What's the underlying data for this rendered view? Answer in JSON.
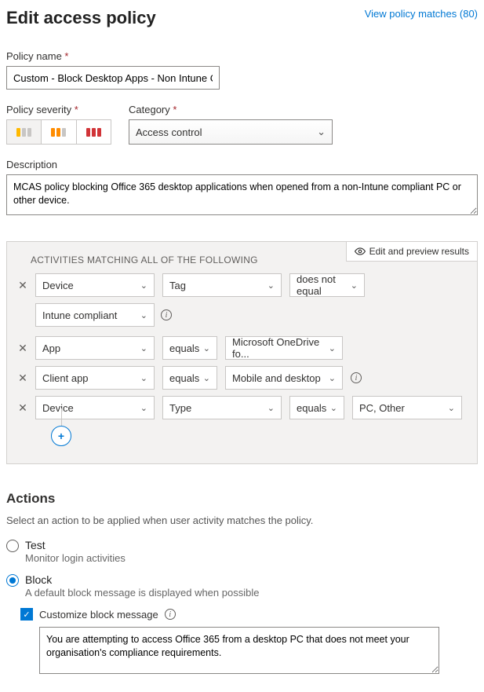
{
  "header": {
    "title": "Edit access policy",
    "view_matches": "View policy matches (80)"
  },
  "policy_name": {
    "label": "Policy name",
    "value": "Custom - Block Desktop Apps - Non Intune Compliar"
  },
  "severity": {
    "label": "Policy severity"
  },
  "category": {
    "label": "Category",
    "value": "Access control"
  },
  "description": {
    "label": "Description",
    "value": "MCAS policy blocking Office 365 desktop applications when opened from a non-Intune compliant PC or other device."
  },
  "filters": {
    "header": "ACTIVITIES MATCHING ALL OF THE FOLLOWING",
    "edit_preview": "Edit and preview results",
    "rows": [
      {
        "field": "Device",
        "sub": "Tag",
        "op": "does not equal",
        "value": "Intune compliant"
      },
      {
        "field": "App",
        "op": "equals",
        "value": "Microsoft OneDrive fo..."
      },
      {
        "field": "Client app",
        "op": "equals",
        "value": "Mobile and desktop"
      },
      {
        "field": "Device",
        "sub": "Type",
        "op": "equals",
        "value": "PC, Other"
      }
    ]
  },
  "actions": {
    "heading": "Actions",
    "desc": "Select an action to be applied when user activity matches the policy.",
    "test_label": "Test",
    "test_sub": "Monitor login activities",
    "block_label": "Block",
    "block_sub": "A default block message is displayed when possible",
    "customize_label": "Customize block message",
    "block_message": "You are attempting to access Office 365 from a desktop PC that does not meet your organisation's compliance requirements."
  }
}
